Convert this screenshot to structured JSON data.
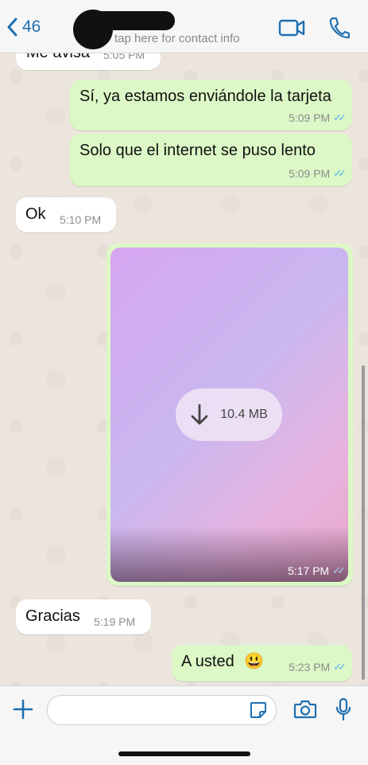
{
  "header": {
    "back_count": "46",
    "subtitle": "tap here for contact info",
    "video_icon": "video-call-icon",
    "call_icon": "phone-icon"
  },
  "messages": [
    {
      "dir": "in",
      "text": "Me avisa",
      "time": "5:05 PM"
    },
    {
      "dir": "out",
      "text": "Sí, ya estamos enviándole la tarjeta",
      "time": "5:09 PM",
      "status": "read"
    },
    {
      "dir": "out",
      "text": "Solo que el internet se puso lento",
      "time": "5:09 PM",
      "status": "read"
    },
    {
      "dir": "in",
      "text": "Ok",
      "time": "5:10 PM"
    },
    {
      "dir": "out",
      "type": "video",
      "size": "10.4 MB",
      "time": "5:17 PM",
      "status": "read"
    },
    {
      "dir": "in",
      "text": "Gracias",
      "time": "5:19 PM"
    },
    {
      "dir": "out",
      "text": "A usted",
      "emoji": "😃",
      "time": "5:23 PM",
      "status": "read"
    }
  ],
  "footer": {
    "plus_icon": "plus-icon",
    "input_value": "",
    "sticker_icon": "sticker-icon",
    "camera_icon": "camera-icon",
    "mic_icon": "microphone-icon"
  },
  "colors": {
    "accent": "#1f6fb0",
    "outgoing_bubble": "#dcf8c6",
    "incoming_bubble": "#ffffff",
    "read_ticks": "#4fb6ec",
    "chat_background": "#ece5dd"
  }
}
